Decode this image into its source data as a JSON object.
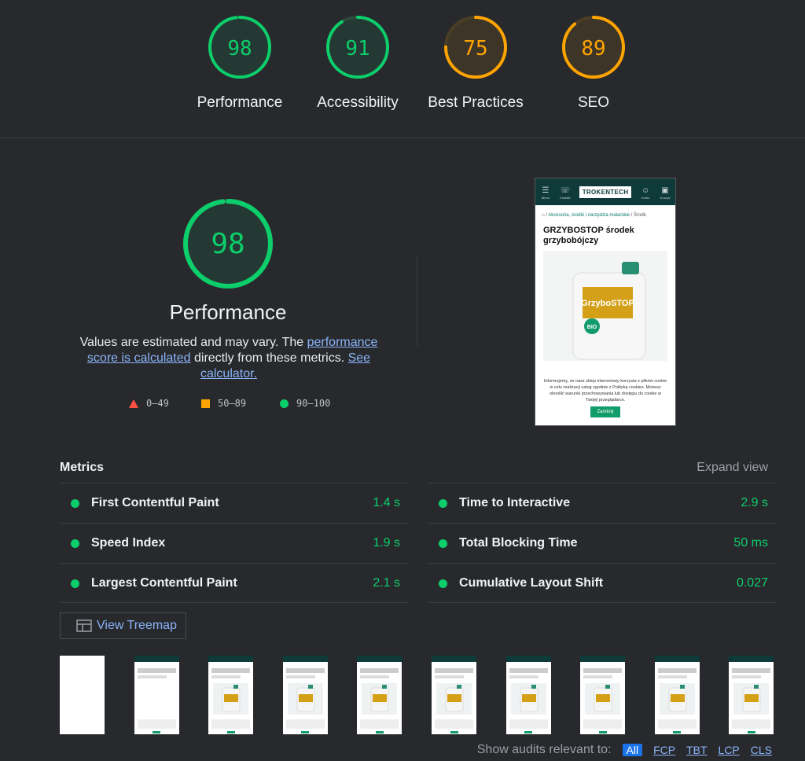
{
  "categories": [
    {
      "label": "Performance",
      "score": 98,
      "rating": "pass"
    },
    {
      "label": "Accessibility",
      "score": 91,
      "rating": "pass"
    },
    {
      "label": "Best Practices",
      "score": 75,
      "rating": "average"
    },
    {
      "label": "SEO",
      "score": 89,
      "rating": "average"
    }
  ],
  "performance": {
    "score": 98,
    "title": "Performance",
    "desc_1": "Values are estimated and may vary. The ",
    "link_calculated": "performance score is calculated",
    "desc_2": " directly from these metrics. ",
    "link_calculator": "See calculator."
  },
  "legend": {
    "fail": "0–49",
    "average": "50–89",
    "pass": "90–100"
  },
  "screenshot": {
    "menu": "Menu",
    "contact": "Kontakt",
    "logo": "TROKENTECH",
    "account": "Konto",
    "cart": "Koszyk",
    "crumb_link": "Akcesoria, środki i narzędzia malarskie",
    "crumb_current": "Środk",
    "product_title": "GRZYBOSTOP środek grzybobójczy",
    "product_label": "GrzyboSTOP",
    "product_badge": "BIO",
    "cookie_text": "Informujemy, że nasz sklep internetowy korzysta z plików cookie w celu realizacji usług zgodnie z Polityką cookies. Możesz określić warunki przechowywania lub dostępu do cookie w Twojej przeglądarce.",
    "cookie_button": "Zamknij"
  },
  "metrics": {
    "title": "Metrics",
    "expand": "Expand view",
    "left": [
      {
        "name": "First Contentful Paint",
        "value": "1.4 s"
      },
      {
        "name": "Speed Index",
        "value": "1.9 s"
      },
      {
        "name": "Largest Contentful Paint",
        "value": "2.1 s"
      }
    ],
    "right": [
      {
        "name": "Time to Interactive",
        "value": "2.9 s"
      },
      {
        "name": "Total Blocking Time",
        "value": "50 ms"
      },
      {
        "name": "Cumulative Layout Shift",
        "value": "0.027"
      }
    ]
  },
  "treemap": {
    "label": "View Treemap"
  },
  "filmstrip": {
    "frame_count": 10
  },
  "filters": {
    "label": "Show audits relevant to:",
    "options": [
      "All",
      "FCP",
      "TBT",
      "LCP",
      "CLS"
    ]
  },
  "colors": {
    "pass": "#0cce6b",
    "average": "#ffa400",
    "fail": "#ff4e42",
    "link": "#8ab4f8"
  }
}
